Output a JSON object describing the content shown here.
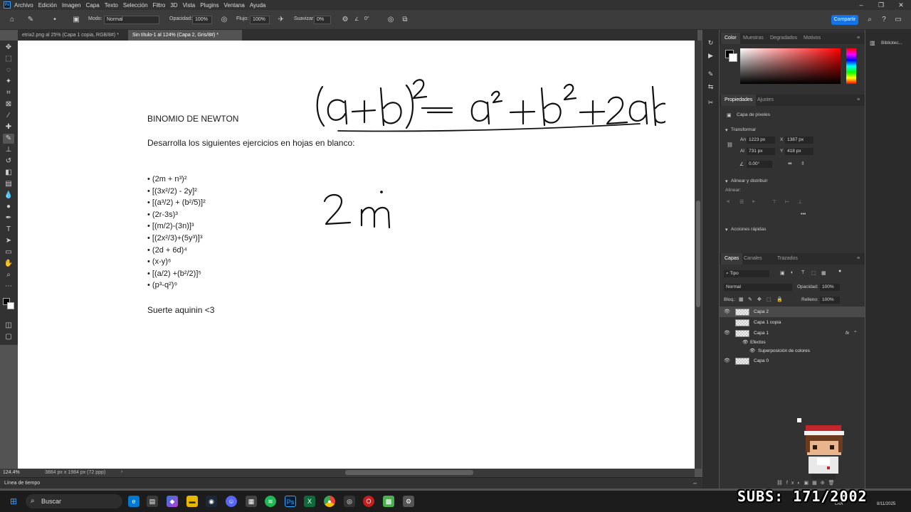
{
  "menubar": {
    "items": [
      "Archivo",
      "Edición",
      "Imagen",
      "Capa",
      "Texto",
      "Selección",
      "Filtro",
      "3D",
      "Vista",
      "Plugins",
      "Ventana",
      "Ayuda"
    ]
  },
  "options": {
    "mode_label": "Modo:",
    "mode_value": "Normal",
    "opacity_label": "Opacidad:",
    "opacity_value": "100%",
    "flow_label": "Flujo:",
    "flow_value": "100%",
    "smooth_label": "Suavizar:",
    "smooth_value": "0%",
    "angle_value": "0°",
    "share_label": "Compartir"
  },
  "tabs": [
    {
      "label": "etria2.png al 25% (Capa 1 copia, RGB/8#) *"
    },
    {
      "label": "Sin título-1 al 124% (Capa 2, Gris/8#) *"
    }
  ],
  "document": {
    "title": "BINOMIO DE NEWTON",
    "instruction": "Desarrolla los siguientes ejercicios en hojas en blanco:",
    "exercises": [
      "• (2m + n³)²",
      "• [(3x²/2) - 2y]²",
      "• [(a³/2) + (b²/5)]²",
      "• (2r-3s)³",
      "• [(m/2)-(3n)]³",
      "• [(2x²/3)+(5y³)]³",
      "• (2d + 6d)⁴",
      "• (x-y)⁶",
      "• [(a/2) +(b²/2)]⁵",
      "• (p³-q²)⁹"
    ],
    "closing": "Suerte aquinin <3"
  },
  "status": {
    "zoom": "124.4%",
    "dims": "3884 px x 1984 px (72 ppp)",
    "timeline_label": "Línea de tiempo"
  },
  "color_panel": {
    "tabs": [
      "Color",
      "Muestras",
      "Degradados",
      "Motivos"
    ],
    "fg_color": "#000000",
    "bg_color": "#ffffff"
  },
  "properties": {
    "tabs": [
      "Propiedades",
      "Ajustes"
    ],
    "layer_kind": "Capa de píxeles",
    "transform_label": "Transformar",
    "w_label": "An",
    "w_value": "1223 px",
    "x_label": "X",
    "x_value": "1387 px",
    "h_label": "Al",
    "h_value": "731 px",
    "y_label": "Y",
    "y_value": "418 px",
    "angle_value": "0.00°",
    "align_label": "Alinear y distribuir",
    "align_sub": "Alinear:",
    "quick_label": "Acciones rápidas"
  },
  "layers_panel": {
    "tabs": [
      "Capas",
      "Canales",
      "Trazados"
    ],
    "filter_label": "Tipo",
    "blend_value": "Normal",
    "opacity_label": "Opacidad:",
    "opacity_value": "100%",
    "lock_label": "Bloq.:",
    "fill_label": "Relleno:",
    "fill_value": "100%",
    "layers": [
      {
        "name": "Capa 2"
      },
      {
        "name": "Capa 1 copia"
      },
      {
        "name": "Capa 1"
      },
      {
        "name": "Efectos"
      },
      {
        "name": "Superposición de colores"
      },
      {
        "name": "Capa 0"
      }
    ]
  },
  "library": {
    "label": "Bibliotec..."
  },
  "taskbar": {
    "search_placeholder": "Buscar",
    "lang": "LAA",
    "date": "8/11/2025"
  },
  "overlay": {
    "subs": "SUBS: 171/2002"
  }
}
